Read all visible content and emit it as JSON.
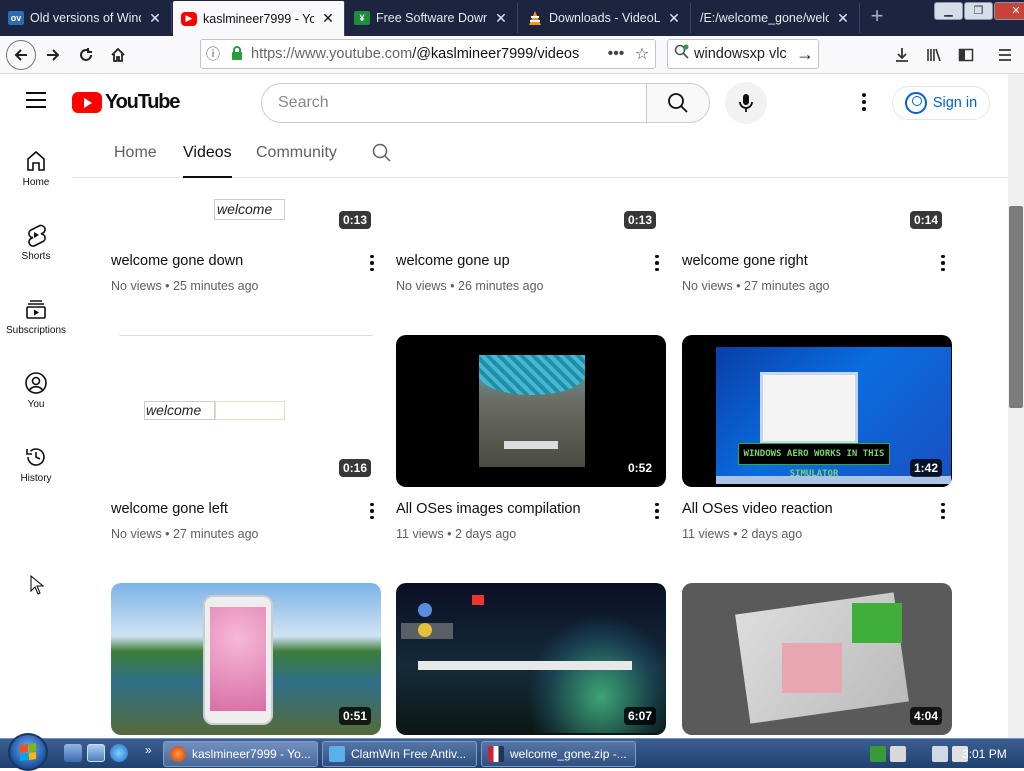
{
  "browser": {
    "tabs": [
      {
        "label": "Old versions of Wind",
        "favicon": "ov"
      },
      {
        "label": "kaslmineer7999 - Yo",
        "favicon": "youtube"
      },
      {
        "label": "Free Software Downl",
        "favicon": "fsd"
      },
      {
        "label": "Downloads - VideoLA",
        "favicon": "vlc"
      },
      {
        "label": "/E:/welcome_gone/welc",
        "favicon": "file"
      }
    ],
    "url_host": "https://www.youtube.com",
    "url_path": "/@kaslmineer7999/videos",
    "search_text": "windowsxp vlc"
  },
  "youtube": {
    "logo_text": "YouTube",
    "search_placeholder": "Search",
    "signin_label": "Sign in",
    "guide": [
      {
        "label": "Home",
        "icon": "home-icon"
      },
      {
        "label": "Shorts",
        "icon": "shorts-icon"
      },
      {
        "label": "Subscriptions",
        "icon": "subscriptions-icon"
      },
      {
        "label": "You",
        "icon": "you-icon"
      },
      {
        "label": "History",
        "icon": "history-icon"
      }
    ],
    "channel_tabs": [
      {
        "label": "Home"
      },
      {
        "label": "Videos",
        "active": true
      },
      {
        "label": "Community"
      }
    ],
    "videos": [
      {
        "title": "welcome gone down",
        "meta": "No views • 25 minutes ago",
        "duration": "0:13",
        "thumb_text": "welcome"
      },
      {
        "title": "welcome gone up",
        "meta": "No views • 26 minutes ago",
        "duration": "0:13"
      },
      {
        "title": "welcome gone right",
        "meta": "No views • 27 minutes ago",
        "duration": "0:14"
      },
      {
        "title": "welcome gone left",
        "meta": "No views • 27 minutes ago",
        "duration": "0:16",
        "thumb_text": "welcome"
      },
      {
        "title": "All OSes images compilation",
        "meta": "11 views • 2 days ago",
        "duration": "0:52"
      },
      {
        "title": "All OSes video reaction",
        "meta": "11 views • 2 days ago",
        "duration": "1:42",
        "thumb_text": "WINDOWS AERO WORKS IN THIS SIMULATOR"
      },
      {
        "title": "",
        "meta": "",
        "duration": "0:51"
      },
      {
        "title": "",
        "meta": "",
        "duration": "6:07"
      },
      {
        "title": "",
        "meta": "",
        "duration": "4:04"
      }
    ]
  },
  "taskbar": {
    "tasks": [
      {
        "label": "kaslmineer7999 - Yo...",
        "active": true
      },
      {
        "label": "ClamWin Free Antiv..."
      },
      {
        "label": "welcome_gone.zip -..."
      }
    ],
    "clock": "3:01 PM"
  },
  "colors": {
    "youtube_red": "#ff0000",
    "link_blue": "#065fd4",
    "tabbar_bg": "#1c2440",
    "taskbar": "#2a4a7c"
  }
}
